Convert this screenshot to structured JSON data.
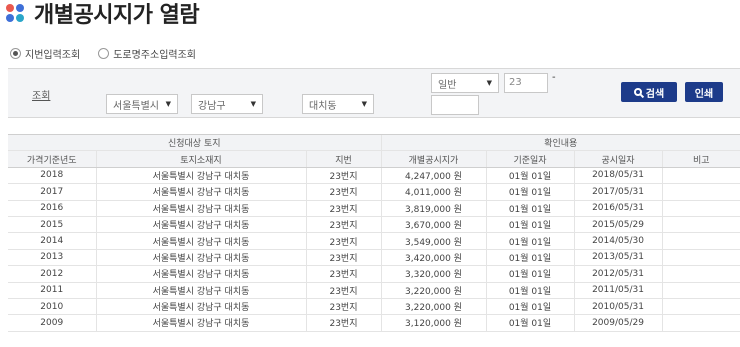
{
  "page": {
    "title": "개별공시지가 열람"
  },
  "search_mode": {
    "options": [
      {
        "label": "지번입력조회",
        "selected": true
      },
      {
        "label": "도로명주소입력조회",
        "selected": false
      }
    ]
  },
  "search": {
    "label": "조회",
    "city": "서울특별시",
    "gu": "강남구",
    "dong": "대치동",
    "lot_type": "일반",
    "lot_main": "23",
    "lot_dash": "-",
    "lot_sub": "",
    "search_button": "검색",
    "print_button": "인쇄"
  },
  "table": {
    "group_headers": [
      "신청대상 토지",
      "확인내용"
    ],
    "columns": [
      "가격기준년도",
      "토지소재지",
      "지번",
      "개별공시지가",
      "기준일자",
      "공시일자",
      "비고"
    ],
    "rows": [
      [
        "2018",
        "서울특별시 강남구 대치동",
        "23번지",
        "4,247,000 원",
        "01월 01일",
        "2018/05/31",
        ""
      ],
      [
        "2017",
        "서울특별시 강남구 대치동",
        "23번지",
        "4,011,000 원",
        "01월 01일",
        "2017/05/31",
        ""
      ],
      [
        "2016",
        "서울특별시 강남구 대치동",
        "23번지",
        "3,819,000 원",
        "01월 01일",
        "2016/05/31",
        ""
      ],
      [
        "2015",
        "서울특별시 강남구 대치동",
        "23번지",
        "3,670,000 원",
        "01월 01일",
        "2015/05/29",
        ""
      ],
      [
        "2014",
        "서울특별시 강남구 대치동",
        "23번지",
        "3,549,000 원",
        "01월 01일",
        "2014/05/30",
        ""
      ],
      [
        "2013",
        "서울특별시 강남구 대치동",
        "23번지",
        "3,420,000 원",
        "01월 01일",
        "2013/05/31",
        ""
      ],
      [
        "2012",
        "서울특별시 강남구 대치동",
        "23번지",
        "3,320,000 원",
        "01월 01일",
        "2012/05/31",
        ""
      ],
      [
        "2011",
        "서울특별시 강남구 대치동",
        "23번지",
        "3,220,000 원",
        "01월 01일",
        "2011/05/31",
        ""
      ],
      [
        "2010",
        "서울특별시 강남구 대치동",
        "23번지",
        "3,220,000 원",
        "01월 01일",
        "2010/05/31",
        ""
      ],
      [
        "2009",
        "서울특별시 강남구 대치동",
        "23번지",
        "3,120,000 원",
        "01월 01일",
        "2009/05/29",
        ""
      ]
    ]
  },
  "colors": {
    "primary_button": "#1d3b8a",
    "header_bg": "#f2f3f5"
  }
}
